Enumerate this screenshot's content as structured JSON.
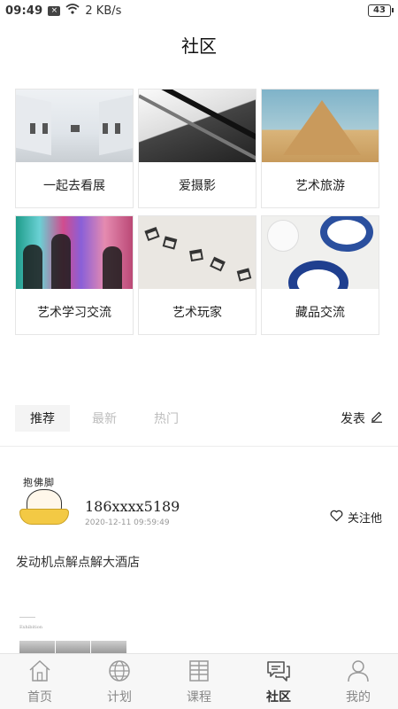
{
  "status_bar": {
    "time": "09:49",
    "network_speed": "2 KB/s",
    "battery": "43"
  },
  "header": {
    "title": "社区"
  },
  "categories": [
    {
      "label": "一起去看展",
      "image": "gallery-photo"
    },
    {
      "label": "爱摄影",
      "image": "escalator-photo"
    },
    {
      "label": "艺术旅游",
      "image": "pyramid-photo"
    },
    {
      "label": "艺术学习交流",
      "image": "colorful-shadows-photo"
    },
    {
      "label": "艺术玩家",
      "image": "chairs-photo"
    },
    {
      "label": "藏品交流",
      "image": "ceramics-photo"
    }
  ],
  "feed_tabs": [
    {
      "label": "推荐",
      "active": true
    },
    {
      "label": "最新",
      "active": false
    },
    {
      "label": "热门",
      "active": false
    }
  ],
  "post_button": {
    "label": "发表",
    "icon": "pencil-icon"
  },
  "post": {
    "avatar_caption": "抱佛脚",
    "username": "186xxxx5189",
    "time": "2020-12-11 09:59:49",
    "follow_label": "关注他",
    "content": "发动机点解点解大酒店",
    "attachment_caption": "Exhibition"
  },
  "bottom_nav": [
    {
      "label": "首页",
      "icon": "home-icon",
      "active": false
    },
    {
      "label": "计划",
      "icon": "globe-icon",
      "active": false
    },
    {
      "label": "课程",
      "icon": "course-icon",
      "active": false
    },
    {
      "label": "社区",
      "icon": "chat-icon",
      "active": true
    },
    {
      "label": "我的",
      "icon": "profile-icon",
      "active": false
    }
  ],
  "colors": {
    "active_text": "#222222",
    "inactive_text": "#bdbdbd",
    "nav_bg": "#f7f7f7"
  }
}
